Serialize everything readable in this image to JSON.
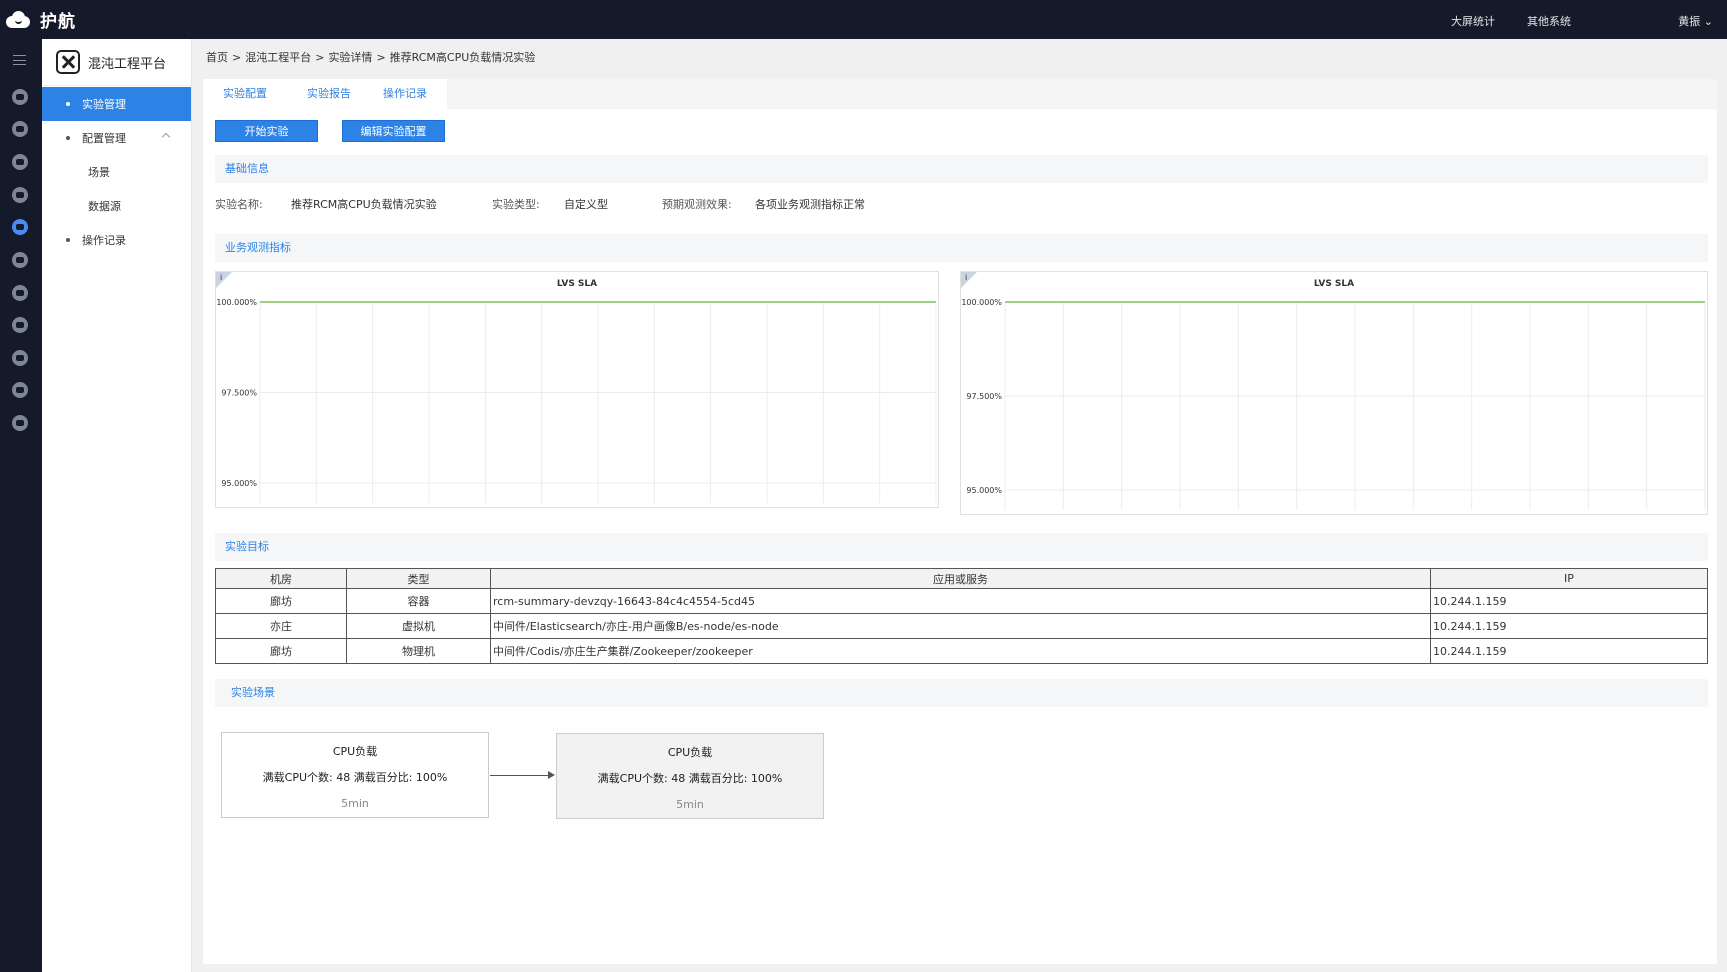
{
  "topbar": {
    "brand": "护航",
    "links": [
      "大屏统计",
      "其他系统"
    ],
    "user": "黄振 ⌄"
  },
  "sidenav": {
    "brand": "混沌工程平台",
    "items": [
      {
        "label": "实验管理"
      },
      {
        "label": "配置管理"
      },
      {
        "label": "场景"
      },
      {
        "label": "数据源"
      },
      {
        "label": "操作记录"
      }
    ]
  },
  "breadcrumb": [
    "首页",
    "混沌工程平台",
    "实验详情",
    "推荐RCM高CPU负载情况实验"
  ],
  "breadcrumb_sep": ">",
  "tabs": [
    "实验配置",
    "实验报告",
    "操作记录"
  ],
  "actions": {
    "start": "开始实验",
    "edit": "编辑实验配置"
  },
  "sections": {
    "basic": "基础信息",
    "metrics": "业务观测指标",
    "targets": "实验目标",
    "scenario": "实验场景"
  },
  "basic_info": {
    "name_label": "实验名称:",
    "name_value": "推荐RCM高CPU负载情况实验",
    "type_label": "实验类型:",
    "type_value": "自定义型",
    "effect_label": "预期观测效果:",
    "effect_value": "各项业务观测指标正常"
  },
  "chart_data": [
    {
      "type": "line",
      "title": "LVS SLA",
      "info_icon": "i",
      "yticks": [
        "100.000%",
        "97.500%",
        "95.000%"
      ],
      "ylim": [
        95,
        100
      ],
      "series": [
        {
          "values": [
            100,
            100
          ]
        }
      ],
      "series_color": "#7fbf5a",
      "grid": true
    },
    {
      "type": "line",
      "title": "LVS SLA",
      "info_icon": "i",
      "yticks": [
        "100.000%",
        "97.500%",
        "95.000%"
      ],
      "ylim": [
        95,
        100
      ],
      "series": [
        {
          "values": [
            100,
            100
          ]
        }
      ],
      "series_color": "#7fbf5a",
      "grid": true
    }
  ],
  "targets_table": {
    "headers": [
      "机房",
      "类型",
      "应用或服务",
      "IP"
    ],
    "rows": [
      [
        "廊坊",
        "容器",
        "rcm-summary-devzqy-16643-84c4c4554-5cd45",
        "10.244.1.159"
      ],
      [
        "亦庄",
        "虚拟机",
        "中间件/Elasticsearch/亦庄-用户画像B/es-node/es-node",
        "10.244.1.159"
      ],
      [
        "廊坊",
        "物理机",
        "中间件/Codis/亦庄生产集群/Zookeeper/zookeeper",
        "10.244.1.159"
      ]
    ]
  },
  "scenario": [
    {
      "title": "CPU负载",
      "params": "满载CPU个数: 48   满载百分比: 100%",
      "duration": "5min"
    },
    {
      "title": "CPU负载",
      "params": "满载CPU个数: 48   满载百分比: 100%",
      "duration": "5min"
    }
  ],
  "colors": {
    "accent": "#2d82e6",
    "topbar": "#141a2a",
    "series": "#7fbf5a"
  }
}
